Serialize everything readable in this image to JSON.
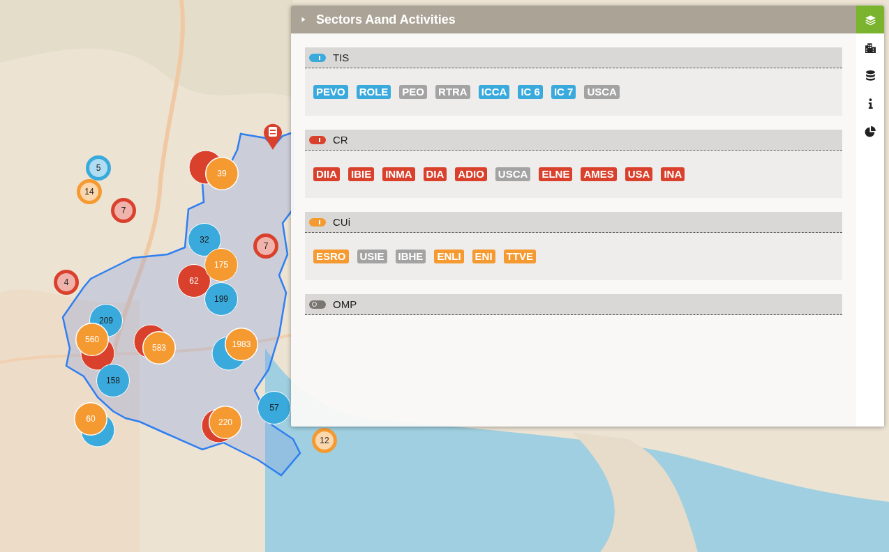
{
  "map": {
    "markers": [
      {
        "kind": "ring",
        "color": "#3aaadc",
        "label": "5"
      },
      {
        "kind": "ring",
        "color": "#f59a31",
        "label": "14"
      },
      {
        "kind": "ring",
        "color": "#d9412c",
        "label": "7"
      },
      {
        "kind": "ring",
        "color": "#d9412c",
        "label": "7"
      },
      {
        "kind": "ring",
        "color": "#d9412c",
        "label": "4"
      },
      {
        "kind": "ring",
        "color": "#f59a31",
        "label": "12"
      },
      {
        "kind": "solid",
        "color": "#f59a31",
        "label": "39",
        "dark_text": false,
        "behind": {
          "color": "#d9412c"
        }
      },
      {
        "kind": "solid",
        "color": "#3aaadc",
        "label": "32",
        "dark_text": true
      },
      {
        "kind": "solid",
        "color": "#d9412c",
        "label": "62",
        "dark_text": false
      },
      {
        "kind": "solid",
        "color": "#f59a31",
        "label": "175",
        "dark_text": false
      },
      {
        "kind": "solid",
        "color": "#3aaadc",
        "label": "199",
        "dark_text": true
      },
      {
        "kind": "solid",
        "color": "#3aaadc",
        "label": "209",
        "dark_text": true
      },
      {
        "kind": "solid",
        "color": "#f59a31",
        "label": "560",
        "dark_text": false,
        "behind": {
          "color": "#d9412c"
        }
      },
      {
        "kind": "solid",
        "color": "#f59a31",
        "label": "583",
        "dark_text": false,
        "behind": {
          "color": "#d9412c"
        }
      },
      {
        "kind": "solid",
        "color": "#f59a31",
        "label": "1983",
        "dark_text": false,
        "behind": {
          "color": "#3aaadc"
        }
      },
      {
        "kind": "solid",
        "color": "#3aaadc",
        "label": "158",
        "dark_text": true
      },
      {
        "kind": "solid",
        "color": "#3aaadc",
        "label": "57",
        "dark_text": true
      },
      {
        "kind": "solid",
        "color": "#f59a31",
        "label": "60",
        "dark_text": false,
        "behind": {
          "color": "#3aaadc"
        }
      },
      {
        "kind": "solid",
        "color": "#f59a31",
        "label": "220",
        "dark_text": false,
        "behind": {
          "color": "#d9412c"
        }
      }
    ]
  },
  "panel": {
    "title": "Sectors Aand Activities",
    "tools": [
      {
        "kind": "layers",
        "selected": true
      },
      {
        "kind": "buildings",
        "selected": false
      },
      {
        "kind": "database",
        "selected": false
      },
      {
        "kind": "info",
        "selected": false
      },
      {
        "kind": "pie",
        "selected": false
      }
    ],
    "groups": [
      {
        "name": "TIS",
        "color": "#3aaadc",
        "on": true,
        "tags": [
          {
            "label": "PEVO",
            "selected": true
          },
          {
            "label": "ROLE",
            "selected": true
          },
          {
            "label": "PEO",
            "selected": false
          },
          {
            "label": "RTRA",
            "selected": false
          },
          {
            "label": "ICCA",
            "selected": true
          },
          {
            "label": "IC 6",
            "selected": true
          },
          {
            "label": "IC 7",
            "selected": true
          },
          {
            "label": "USCA",
            "selected": false
          }
        ]
      },
      {
        "name": "CR",
        "color": "#d9412c",
        "on": true,
        "tags": [
          {
            "label": "DIIA",
            "selected": true
          },
          {
            "label": "IBIE",
            "selected": true
          },
          {
            "label": "INMA",
            "selected": true
          },
          {
            "label": "DIA",
            "selected": true
          },
          {
            "label": "ADIO",
            "selected": true
          },
          {
            "label": "USCA",
            "selected": false
          },
          {
            "label": "ELNE",
            "selected": true
          },
          {
            "label": "AMES",
            "selected": true
          },
          {
            "label": "USA",
            "selected": true
          },
          {
            "label": "INA",
            "selected": true
          }
        ]
      },
      {
        "name": "CUi",
        "color": "#f59a31",
        "on": true,
        "tags": [
          {
            "label": "ESRO",
            "selected": true
          },
          {
            "label": "USIE",
            "selected": false
          },
          {
            "label": "IBHE",
            "selected": false
          },
          {
            "label": "ENLI",
            "selected": true
          },
          {
            "label": "ENI",
            "selected": true
          },
          {
            "label": "TTVE",
            "selected": true
          }
        ]
      },
      {
        "name": "OMP",
        "color": "#7a7672",
        "on": false
      }
    ]
  }
}
